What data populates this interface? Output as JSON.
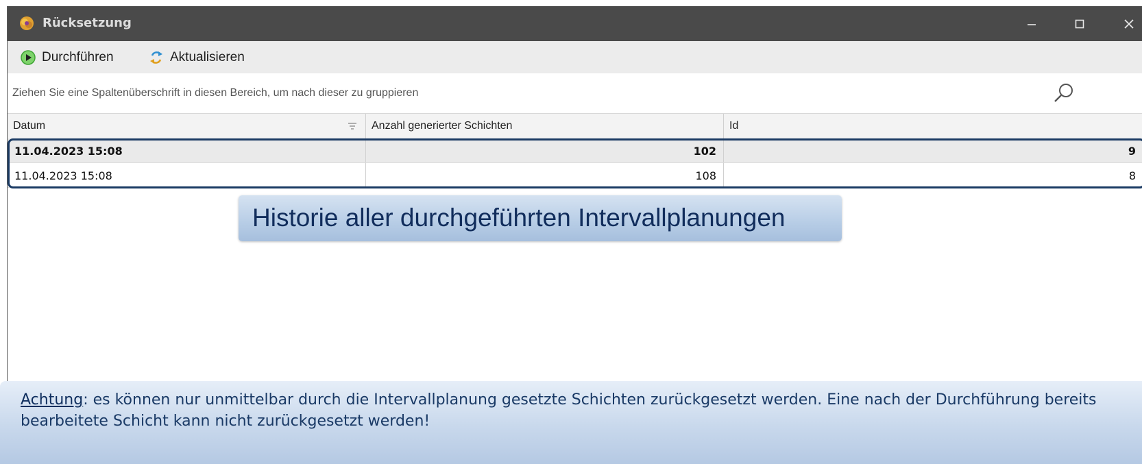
{
  "window": {
    "title": "Rücksetzung",
    "controls": {
      "minimize": "minimize-icon",
      "maximize": "maximize-icon",
      "close": "close-icon"
    }
  },
  "toolbar": {
    "run_label": "Durchführen",
    "refresh_label": "Aktualisieren"
  },
  "group_panel": {
    "hint": "Ziehen Sie eine Spaltenüberschrift in diesen Bereich, um nach dieser zu gruppieren"
  },
  "grid": {
    "columns": [
      "Datum",
      "Anzahl generierter Schichten",
      "Id"
    ],
    "rows": [
      {
        "datum": "11.04.2023 15:08",
        "anzahl": "102",
        "id": "9"
      },
      {
        "datum": "11.04.2023 15:08",
        "anzahl": "108",
        "id": "8"
      }
    ]
  },
  "callout": {
    "text": "Historie aller durchgeführten Intervallplanungen"
  },
  "note": {
    "label": "Achtung",
    "text": ": es können nur unmittelbar durch die Intervallplanung gesetzte Schichten zurückgesetzt werden. Eine nach der Durchführung bereits bearbeitete Schicht kann nicht zurückgesetzt werden!"
  },
  "colors": {
    "titlebar": "#4a4a4a",
    "highlight_border": "#1a3a63",
    "callout_text": "#112d5c",
    "note_text": "#1a3a66",
    "run_icon": "#3fa535"
  }
}
